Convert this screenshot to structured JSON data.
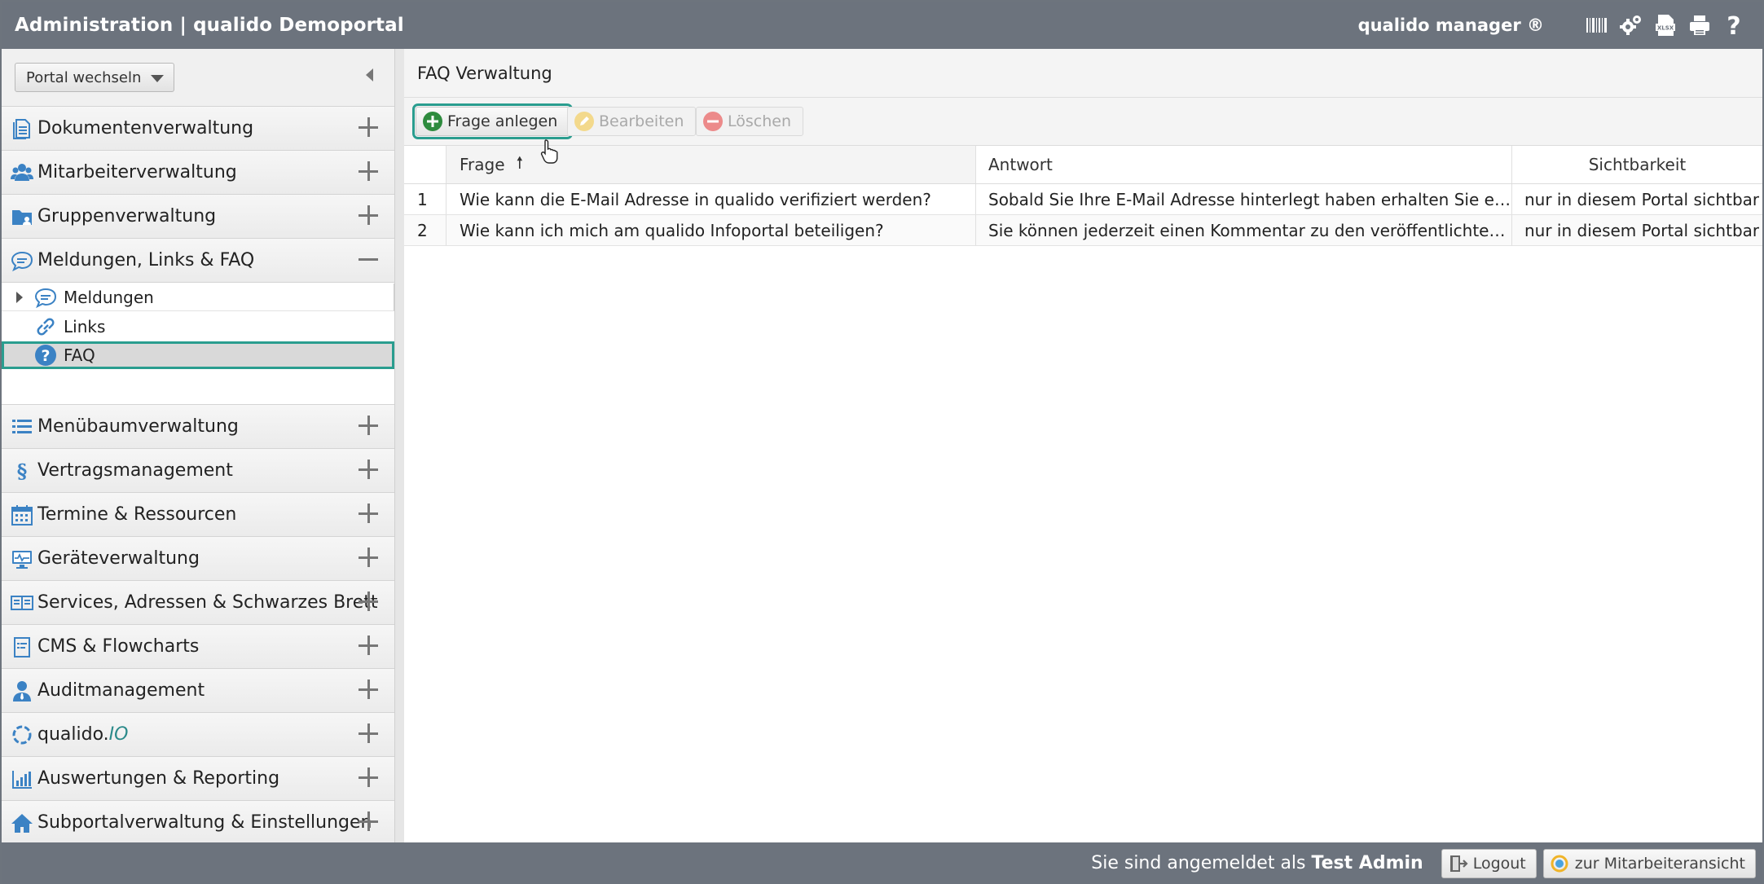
{
  "topbar": {
    "title": "Administration | qualido Demoportal",
    "brand": "qualido manager ®",
    "icons": [
      "barcode-icon",
      "gears-icon",
      "xlsx-export-icon",
      "print-icon",
      "help-icon"
    ]
  },
  "sidebar": {
    "portal_switch_label": "Portal wechseln",
    "items": [
      {
        "label": "Dokumentenverwaltung",
        "icon": "documents-icon"
      },
      {
        "label": "Mitarbeiterverwaltung",
        "icon": "users-icon"
      },
      {
        "label": "Gruppenverwaltung",
        "icon": "group-folder-icon"
      },
      {
        "label": "Meldungen, Links & FAQ",
        "icon": "chat-bubble-icon",
        "expanded": true
      },
      {
        "label": "Menübaumverwaltung",
        "icon": "list-icon"
      },
      {
        "label": "Vertragsmanagement",
        "icon": "paragraph-icon"
      },
      {
        "label": "Termine & Ressourcen",
        "icon": "calendar-icon"
      },
      {
        "label": "Geräteverwaltung",
        "icon": "monitor-icon"
      },
      {
        "label": "Services, Adressen & Schwarzes Brett",
        "icon": "address-book-icon"
      },
      {
        "label": "CMS & Flowcharts",
        "icon": "cms-icon"
      },
      {
        "label": "Auditmanagement",
        "icon": "auditor-icon"
      },
      {
        "label": "qualido.",
        "suffix": "IO",
        "icon": "qualido-io-icon"
      },
      {
        "label": "Auswertungen & Reporting",
        "icon": "bar-chart-icon"
      },
      {
        "label": "Subportalverwaltung & Einstellungen",
        "icon": "home-icon"
      }
    ],
    "subitems": [
      {
        "label": "Meldungen",
        "icon": "chat-bubble-icon"
      },
      {
        "label": "Links",
        "icon": "link-icon"
      },
      {
        "label": "FAQ",
        "icon": "question-icon",
        "selected": true
      }
    ]
  },
  "main": {
    "title": "FAQ Verwaltung",
    "toolbar": {
      "add_label": "Frage anlegen",
      "edit_label": "Bearbeiten",
      "delete_label": "Löschen"
    },
    "table": {
      "columns": [
        "Frage",
        "Antwort",
        "Sichtbarkeit"
      ],
      "sort_indicator": "🠕",
      "rows": [
        {
          "num": "1",
          "frage": "Wie kann die E-Mail Adresse in qualido verifiziert werden?",
          "antwort": "Sobald Sie Ihre E-Mail Adresse hinterlegt haben erhalten Sie eine E-Mail",
          "sichtbarkeit": "nur in diesem Portal sichtbar"
        },
        {
          "num": "2",
          "frage": "Wie kann ich mich am qualido Infoportal beteiligen?",
          "antwort": "Sie können jederzeit einen Kommentar zu den veröffentlichten Dokumenten",
          "sichtbarkeit": "nur in diesem Portal sichtbar"
        }
      ]
    }
  },
  "footer": {
    "logged_prefix": "Sie sind angemeldet als",
    "user": "Test Admin",
    "logout_label": "Logout",
    "employee_view_label": "zur Mitarbeiteransicht"
  },
  "colors": {
    "bar": "#6c737d",
    "accent": "#2a9d8f",
    "icon_blue": "#3b82c4",
    "add_green": "#2e8b3e",
    "delete_red": "#e05555",
    "edit_yellow": "#e9c46a"
  }
}
